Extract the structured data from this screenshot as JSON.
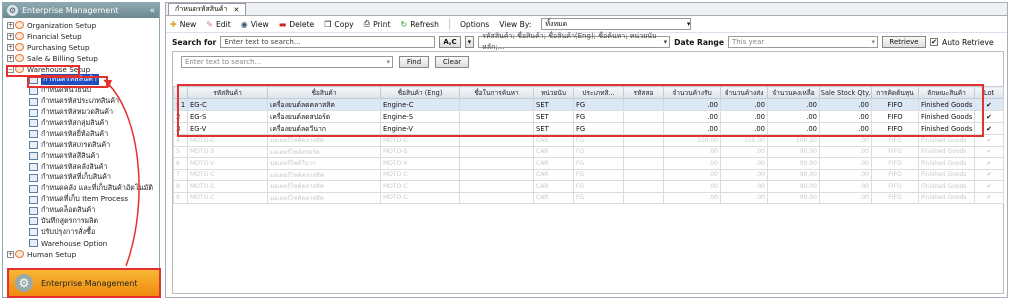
{
  "left_panel": {
    "title": "Enterprise Management",
    "collapse_glyph": "«",
    "tree": [
      {
        "label": "Organization Setup",
        "level": 0,
        "expanded": false
      },
      {
        "label": "Financial Setup",
        "level": 0,
        "expanded": false
      },
      {
        "label": "Purchasing Setup",
        "level": 0,
        "expanded": false
      },
      {
        "label": "Sale & Billing Setup",
        "level": 0,
        "expanded": false
      },
      {
        "label": "Warehouse Setup",
        "level": 0,
        "expanded": true
      },
      {
        "label": "กำหนดรหัสสินค้า",
        "level": 1,
        "selected": true
      },
      {
        "label": "กำหนดหน่วยนับ",
        "level": 1
      },
      {
        "label": "กำหนดรหัสประเภทสินค้า",
        "level": 1
      },
      {
        "label": "กำหนดรหัสหมวดสินค้า",
        "level": 1
      },
      {
        "label": "กำหนดรหัสกลุ่มสินค้า",
        "level": 1
      },
      {
        "label": "กำหนดรหัสยี่ห้อสินค้า",
        "level": 1
      },
      {
        "label": "กำหนดรหัสเกรดสินค้า",
        "level": 1
      },
      {
        "label": "กำหนดรหัสสีสินค้า",
        "level": 1
      },
      {
        "label": "กำหนดรหัสคลังสินค้า",
        "level": 1
      },
      {
        "label": "กำหนดรหัสที่เก็บสินค้า",
        "level": 1
      },
      {
        "label": "กำหนดคลัง และที่เก็บสินค้าอัตโนมัติ",
        "level": 1
      },
      {
        "label": "กำหนดที่เก็บ Item Process",
        "level": 1
      },
      {
        "label": "กำหนดล็อตสินค้า",
        "level": 1
      },
      {
        "label": "บันทึกสูตรการผลิต",
        "level": 1
      },
      {
        "label": "ปรับปรุงการสั่งซื้อ",
        "level": 1
      },
      {
        "label": "Warehouse Option",
        "level": 1
      },
      {
        "label": "Human Setup",
        "level": 0,
        "expanded": false
      }
    ],
    "bottom_button": "Enterprise Management"
  },
  "tab": {
    "label": "กำหนดรหัสสินค้า",
    "close": "✕"
  },
  "toolbar": {
    "new": "New",
    "edit": "Edit",
    "view": "View",
    "delete": "Delete",
    "copy": "Copy",
    "print": "Print",
    "refresh": "Refresh",
    "options": "Options",
    "view_by_label": "View By:",
    "view_by_value": "ทั้งหมด"
  },
  "search": {
    "label": "Search for",
    "placeholder": "Enter text to search...",
    "mode": "A,C",
    "fields": "รหัสสินค้า; ชื่อสินค้า; ชื่อสินค้า(Eng); ชื่อค้นหา; หน่วยนับหลัก;...",
    "date_range_label": "Date Range",
    "date_range_value": "This year",
    "retrieve": "Retrieve",
    "auto_retrieve": "Auto Retrieve"
  },
  "filter": {
    "placeholder": "Enter text to search...",
    "find": "Find",
    "clear": "Clear"
  },
  "grid": {
    "columns": [
      "",
      "รหัสสินค้า",
      "ชื่อสินค้า",
      "ชื่อสินค้า (Eng)",
      "ชื่อในการค้นหา",
      "หน่วยนับ",
      "ประเภทสิ...",
      "รหัสสอ",
      "จำนวนค้างรับ",
      "จำนวนค้างส่ง",
      "จำนวนคงเหลือ",
      "Sale Stock Qty.",
      "การคิดต้นทุน",
      "ลักษณะสินค้า",
      "Lot"
    ],
    "rows": [
      [
        "› 1",
        "EG-C",
        "เครื่องยนต์ลดคลาสสิค",
        "Engine-C",
        "",
        "SET",
        "FG",
        "",
        ".00",
        ".00",
        ".00",
        ".00",
        "FIFO",
        "Finished Goods",
        "✔"
      ],
      [
        "2",
        "EG-S",
        "เครื่องยนต์ลดสปอร์ต",
        "Engine-S",
        "",
        "SET",
        "FG",
        "",
        ".00",
        ".00",
        ".00",
        ".00",
        "FIFO",
        "Finished Goods",
        "✔"
      ],
      [
        "3",
        "EG-V",
        "เครื่องยนต์ลดวีนาก",
        "Engine-V",
        "",
        "SET",
        "FG",
        "",
        ".00",
        ".00",
        ".00",
        ".00",
        "FIFO",
        "Finished Goods",
        "✔"
      ]
    ],
    "blurred_rows": [
      [
        "4",
        "MOTO-C",
        "มอเตอร์ไซค์คลาสสิค",
        "MOTO-C",
        "",
        "CAR",
        "FG",
        "",
        "100.00",
        "100.00",
        "100.00",
        ".00",
        "FIFO",
        "Finished Goods",
        "✔"
      ],
      [
        "5",
        "MOTO-S",
        "มอเตอร์ไซค์สปอร์ต",
        "MOTO-S",
        "",
        "CAR",
        "FG",
        "",
        ".00",
        ".00",
        "90.00",
        ".00",
        "FIFO",
        "Finished Goods",
        "✔"
      ],
      [
        "6",
        "MOTO-V",
        "มอเตอร์ไซค์วีนาก",
        "MOTO-V",
        "",
        "CAR",
        "FG",
        "",
        ".00",
        ".00",
        "90.00",
        ".00",
        "FIFO",
        "Finished Goods",
        "✔"
      ],
      [
        "7",
        "MOTO-C",
        "มอเตอร์ไซค์คลาสสิค",
        "MOTO-C",
        "",
        "CAR",
        "FG",
        "",
        ".00",
        ".00",
        "90.00",
        ".00",
        "FIFO",
        "Finished Goods",
        "✔"
      ],
      [
        "8",
        "MOTO-C",
        "มอเตอร์ไซค์คลาสสิค",
        "MOTO-C",
        "",
        "CAR",
        "FG",
        "",
        ".00",
        ".00",
        "90.00",
        ".00",
        "FIFO",
        "Finished Goods",
        "✔"
      ],
      [
        "9",
        "MOTO-C",
        "มอเตอร์ไซค์คลาสสิค",
        "MOTO-C",
        "",
        "CAR",
        "FG",
        "",
        ".00",
        ".00",
        "90.00",
        ".00",
        "FIFO",
        "Finished Goods",
        "✔"
      ]
    ]
  },
  "colors": {
    "highlight": "#e53030",
    "selection": "#1f4fbf",
    "accent": "#f5a623"
  }
}
